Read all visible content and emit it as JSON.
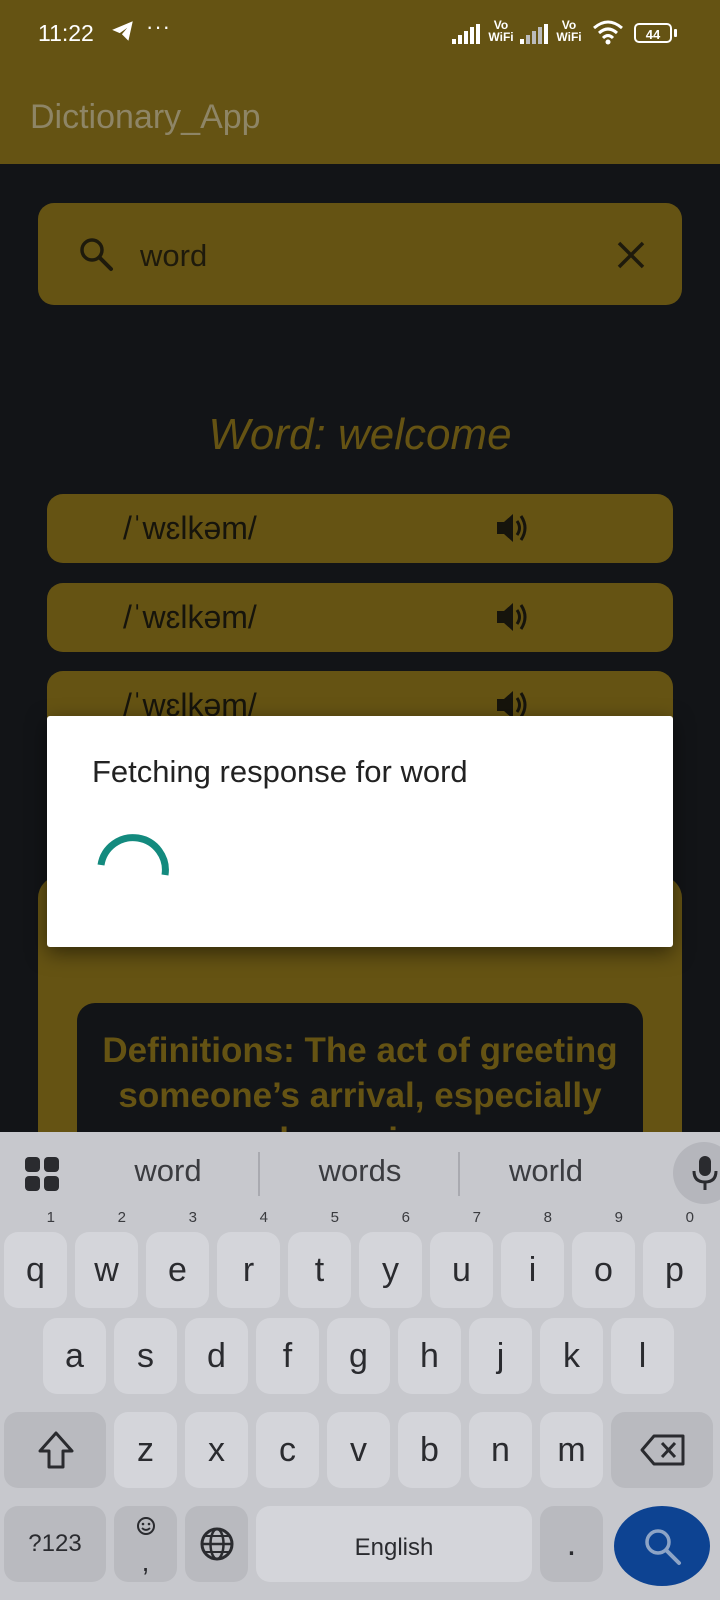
{
  "status_bar": {
    "time": "11:22",
    "more": "···",
    "volte_1": "Vo\nWiFi",
    "volte_2": "Vo\nWiFi",
    "battery": "44"
  },
  "app_bar": {
    "title": "Dictionary_App"
  },
  "search": {
    "value": "word"
  },
  "result": {
    "heading": "Word: welcome",
    "pronunciations": [
      "/ˈwɛlkəm/",
      "/ˈwɛlkəm/",
      "/ˈwɛlkəm/"
    ],
    "definition": "Definitions: The act of greeting someone’s arrival, especially by saying"
  },
  "dialog": {
    "title": "Fetching response for word"
  },
  "keyboard": {
    "suggestions": [
      "word",
      "words",
      "world"
    ],
    "row1": [
      {
        "k": "q",
        "h": "1"
      },
      {
        "k": "w",
        "h": "2"
      },
      {
        "k": "e",
        "h": "3"
      },
      {
        "k": "r",
        "h": "4"
      },
      {
        "k": "t",
        "h": "5"
      },
      {
        "k": "y",
        "h": "6"
      },
      {
        "k": "u",
        "h": "7"
      },
      {
        "k": "i",
        "h": "8"
      },
      {
        "k": "o",
        "h": "9"
      },
      {
        "k": "p",
        "h": "0"
      }
    ],
    "row2": [
      "a",
      "s",
      "d",
      "f",
      "g",
      "h",
      "j",
      "k",
      "l"
    ],
    "row3": [
      "z",
      "x",
      "c",
      "v",
      "b",
      "n",
      "m"
    ],
    "symbols_label": "?123",
    "comma": ",",
    "space_label": "English",
    "period": "."
  },
  "colors": {
    "accent_dimmed": "#655313",
    "background": "#121417",
    "spinner": "#138a7e",
    "enter_key": "#0d4392"
  },
  "icons": [
    "telegram-icon",
    "signal-icon",
    "wifi-icon",
    "battery-icon",
    "search-icon",
    "close-icon",
    "speaker-icon",
    "apps-grid-icon",
    "mic-icon",
    "shift-icon",
    "backspace-icon",
    "emoji-icon",
    "globe-icon"
  ]
}
